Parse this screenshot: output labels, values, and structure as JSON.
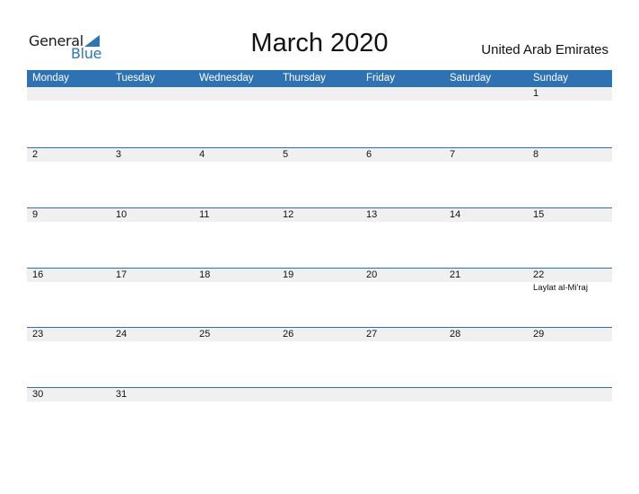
{
  "logo": {
    "word1": "General",
    "word2": "Blue",
    "icon": "triangle-flag-icon"
  },
  "title": "March 2020",
  "country": "United Arab Emirates",
  "colors": {
    "accent": "#2e72b3",
    "band": "#f0f0f0"
  },
  "weekdays": [
    "Monday",
    "Tuesday",
    "Wednesday",
    "Thursday",
    "Friday",
    "Saturday",
    "Sunday"
  ],
  "weeks": [
    {
      "days": [
        "",
        "",
        "",
        "",
        "",
        "",
        "1"
      ]
    },
    {
      "days": [
        "2",
        "3",
        "4",
        "5",
        "6",
        "7",
        "8"
      ]
    },
    {
      "days": [
        "9",
        "10",
        "11",
        "12",
        "13",
        "14",
        "15"
      ]
    },
    {
      "days": [
        "16",
        "17",
        "18",
        "19",
        "20",
        "21",
        "22"
      ],
      "holidays": [
        "",
        "",
        "",
        "",
        "",
        "",
        "Laylat al-Mi'raj"
      ]
    },
    {
      "days": [
        "23",
        "24",
        "25",
        "26",
        "27",
        "28",
        "29"
      ]
    },
    {
      "days": [
        "30",
        "31",
        "",
        "",
        "",
        "",
        ""
      ]
    }
  ]
}
